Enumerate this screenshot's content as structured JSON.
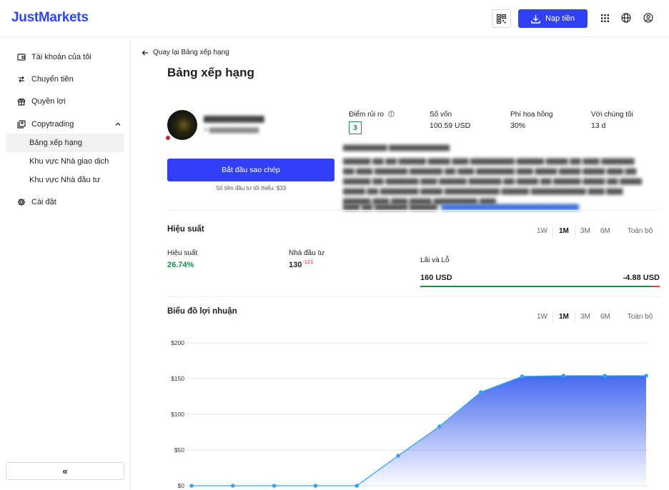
{
  "header": {
    "logo": "JustMarkets",
    "deposit_label": "Nạp tiền"
  },
  "sidebar": {
    "items": [
      {
        "label": "Tài khoản của tôi"
      },
      {
        "label": "Chuyển tiền"
      },
      {
        "label": "Quyền lợi"
      },
      {
        "label": "Copytrading"
      }
    ],
    "copytrading_sub": [
      {
        "label": "Bảng xếp hạng"
      },
      {
        "label": "Khu vực Nhà giao dịch"
      },
      {
        "label": "Khu vực Nhà đầu tư"
      }
    ],
    "settings": "Cài đặt",
    "collapse": "«"
  },
  "page": {
    "back": "Quay lại Bảng xếp hạng",
    "title": "Bảng xếp hạng"
  },
  "trader": {
    "copy_button": "Bắt đầu sao chép",
    "min_invest": "Số tiền đầu tư tối thiểu: $33",
    "stats": [
      {
        "label": "Điểm rủi ro",
        "value": "3"
      },
      {
        "label": "Số vốn",
        "value": "100.59 USD"
      },
      {
        "label": "Phí hoa hồng",
        "value": "30%"
      },
      {
        "label": "Với chúng tôi",
        "value": "13 d"
      }
    ]
  },
  "performance": {
    "title": "Hiệu suất",
    "periods": [
      "1W",
      "1M",
      "3M",
      "6M",
      "Toàn bộ"
    ],
    "selected_period": "1M",
    "return_label": "Hiệu suất",
    "return_value": "26.74%",
    "investors_label": "Nhà đầu tư",
    "investors_value": "130",
    "investors_delta": "-121",
    "pnl_label": "Lãi và Lỗ",
    "profit": "160 USD",
    "loss": "-4.88 USD"
  },
  "profit_chart": {
    "title": "Biểu đồ lợi nhuận",
    "periods": [
      "1W",
      "1M",
      "3M",
      "6M",
      "Toàn bộ"
    ],
    "selected_period": "1M",
    "colors": {
      "line": "#3aa3ec",
      "fill_top": "#3a62ef",
      "grid": "#e6e6e6"
    }
  },
  "chart_data": {
    "type": "area",
    "title": "Biểu đồ lợi nhuận",
    "xlabel": "",
    "ylabel": "",
    "ylim": [
      0,
      200
    ],
    "yticks": [
      "$0",
      "$50",
      "$100",
      "$150",
      "$200"
    ],
    "grid": true,
    "x": [
      1,
      2,
      3,
      4,
      5,
      6,
      7,
      8,
      9,
      10,
      11,
      12
    ],
    "values": [
      0,
      0,
      0,
      0,
      0,
      42,
      83,
      131,
      153,
      154,
      154,
      154
    ]
  }
}
